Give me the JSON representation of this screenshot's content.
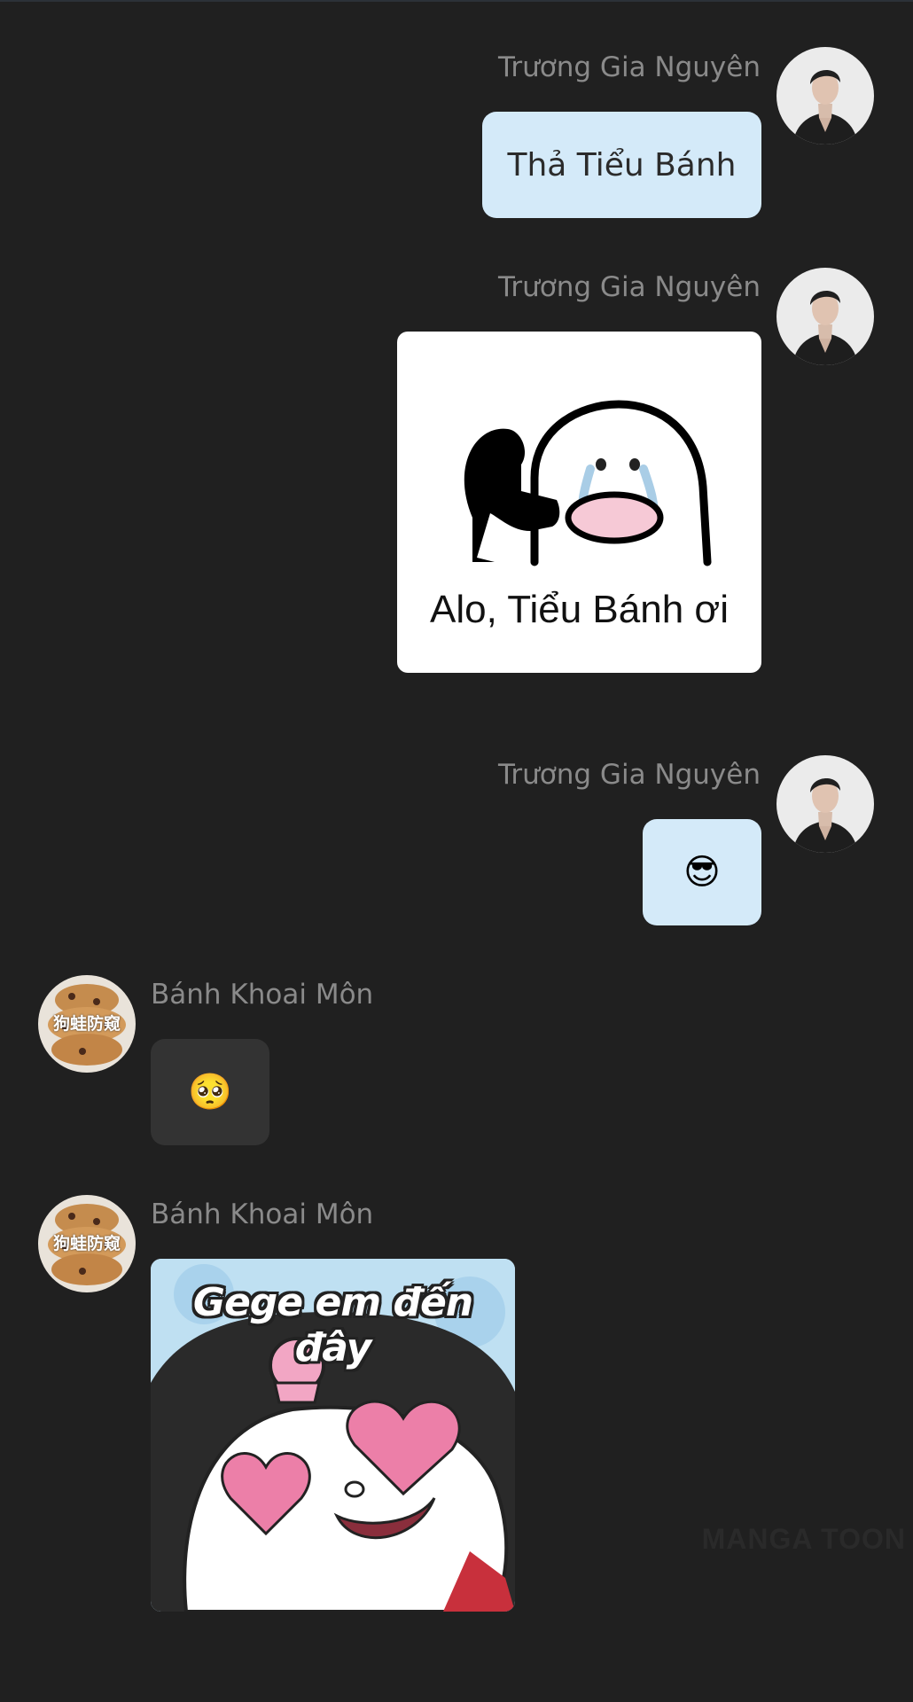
{
  "messages": [
    {
      "sender": "Trương Gia Nguyên",
      "text": "Thả Tiểu Bánh"
    },
    {
      "sender": "Trương Gia Nguyên",
      "sticker_caption": "Alo, Tiểu Bánh ơi"
    },
    {
      "sender": "Trương Gia Nguyên",
      "emoji": "😎"
    },
    {
      "sender": "Bánh Khoai Môn",
      "emoji": "🥺"
    },
    {
      "sender": "Bánh Khoai Môn",
      "sticker_caption": "Gege em đến đây"
    }
  ],
  "avatar_b_text": "狗蛙防窥",
  "watermark": "MANGA TOON",
  "icons": {
    "avatar_a": "man-portrait-avatar",
    "avatar_b": "bread-avatar"
  },
  "colors": {
    "background": "#202020",
    "outgoing_bubble": "#d4eaf9",
    "incoming_bubble": "#333333",
    "sender_name": "#8a8a8a"
  }
}
